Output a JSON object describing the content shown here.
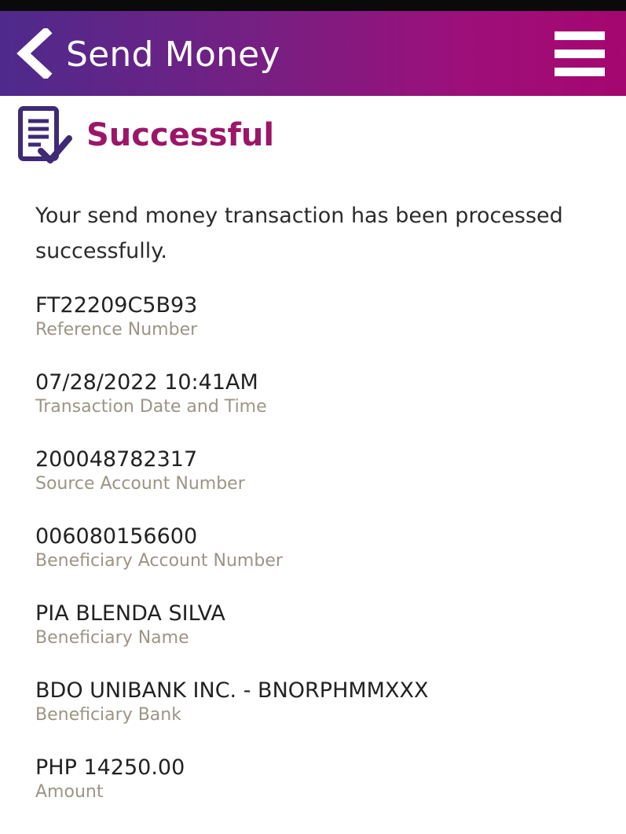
{
  "header": {
    "title": "Send Money",
    "back_icon": "chevron-left-icon",
    "menu_icon": "hamburger-menu-icon",
    "gradient_start": "#4e2a8c",
    "gradient_end": "#a5066f"
  },
  "status": {
    "icon": "document-check-icon",
    "title": "Successful",
    "title_color": "#9b1668",
    "message": "Your send money transaction has been processed successfully."
  },
  "details": [
    {
      "value": "FT22209C5B93",
      "label": "Reference Number"
    },
    {
      "value": "07/28/2022 10:41AM",
      "label": "Transaction Date and Time"
    },
    {
      "value": "200048782317",
      "label": "Source Account Number"
    },
    {
      "value": "006080156600",
      "label": "Beneficiary Account Number"
    },
    {
      "value": "PIA BLENDA SILVA",
      "label": "Beneficiary Name"
    },
    {
      "value": "BDO UNIBANK INC. - BNORPHMMXXX",
      "label": "Beneficiary Bank"
    },
    {
      "value": "PHP 14250.00",
      "label": "Amount"
    }
  ],
  "colors": {
    "value_text": "#222222",
    "label_text": "#9c9586",
    "icon_color": "#3f2a75"
  }
}
